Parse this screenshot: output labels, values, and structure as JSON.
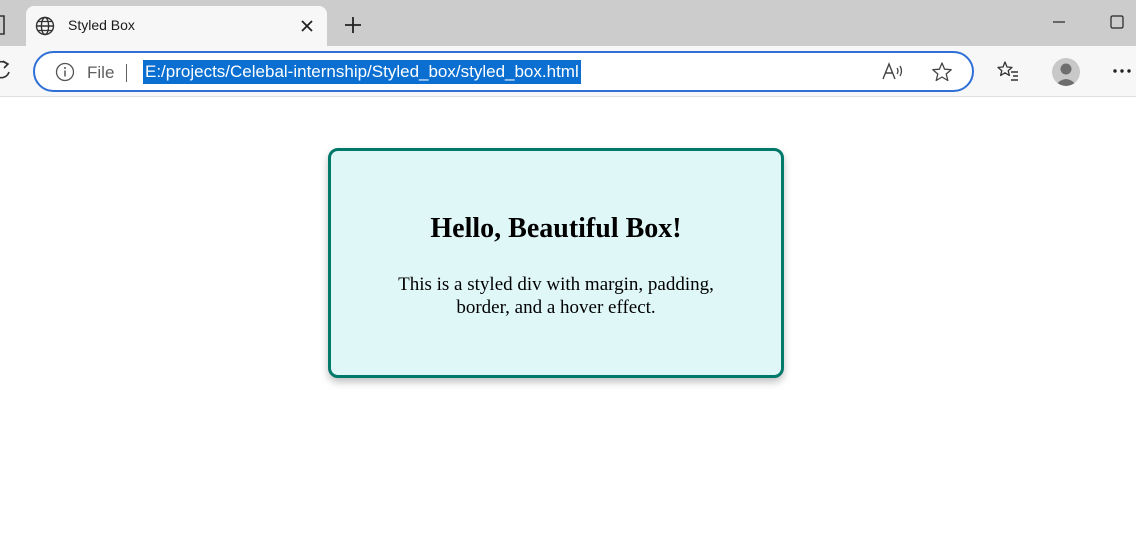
{
  "browser": {
    "tab": {
      "title": "Styled Box",
      "icon": "globe-icon"
    },
    "address_bar": {
      "scheme_label": "File",
      "url": "E:/projects/Celebal-internship/Styled_box/styled_box.html",
      "selection_color": "#0a6fd1",
      "focus_color": "#2f6fd6"
    }
  },
  "page": {
    "heading": "Hello, Beautiful Box!",
    "description": "This is a styled div with margin, padding, border, and a hover effect.",
    "box_background": "#e0f7f8",
    "box_border_color": "#00796b"
  }
}
